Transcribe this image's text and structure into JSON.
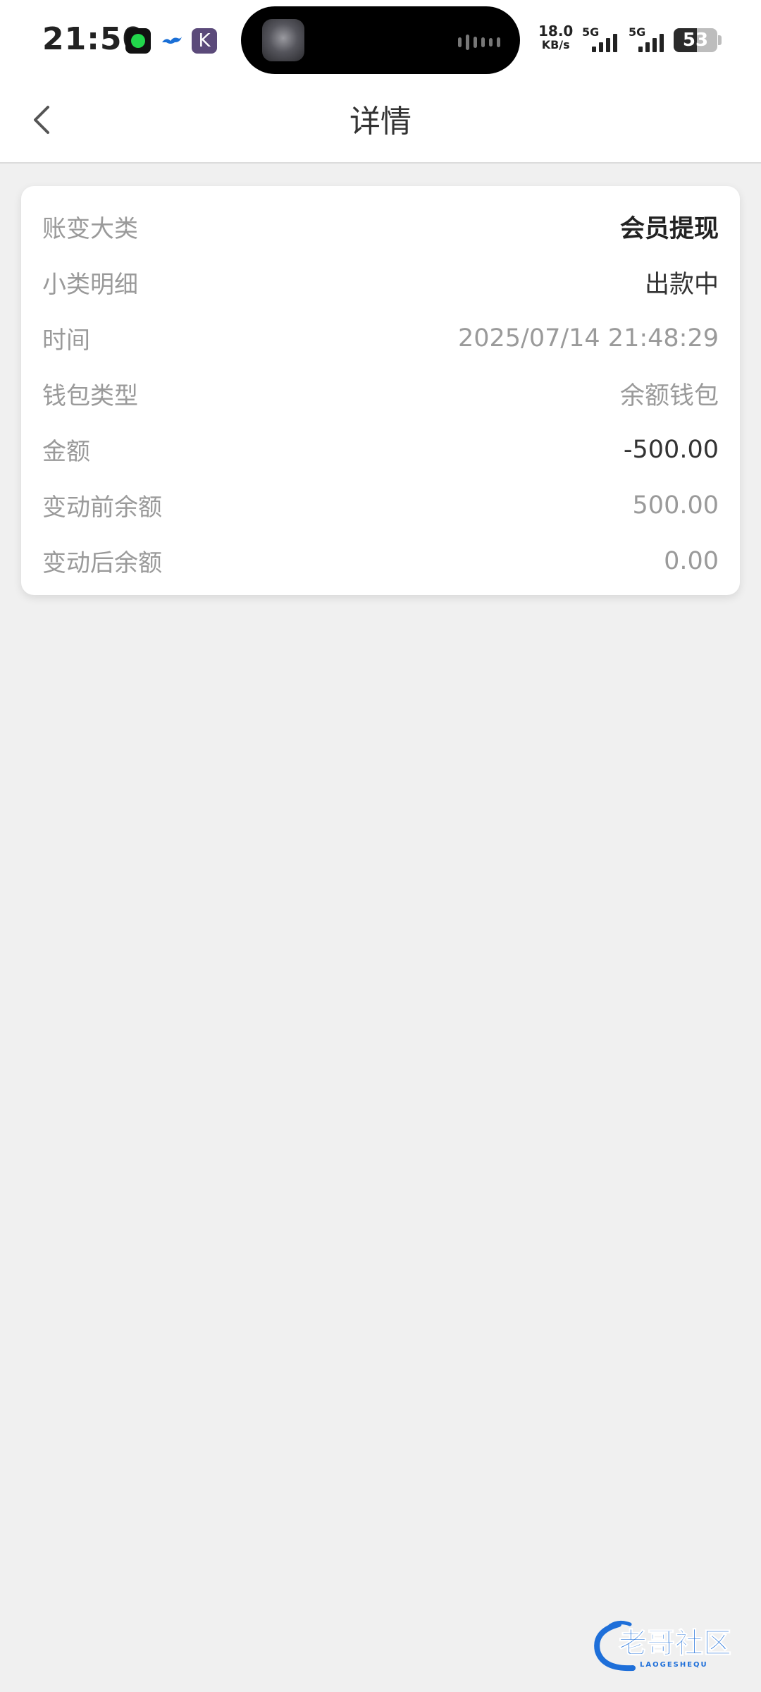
{
  "status_bar": {
    "time": "21:50",
    "net_speed_value": "18.0",
    "net_speed_unit": "KB/s",
    "signal1_label": "5G",
    "signal2_label": "5G",
    "battery_level": "53"
  },
  "header": {
    "title": "详情"
  },
  "detail": {
    "rows": [
      {
        "label": "账变大类",
        "value": "会员提现"
      },
      {
        "label": "小类明细",
        "value": "出款中"
      },
      {
        "label": "时间",
        "value": "2025/07/14 21:48:29"
      },
      {
        "label": "钱包类型",
        "value": "余额钱包"
      },
      {
        "label": "金额",
        "value": "-500.00"
      },
      {
        "label": "变动前余额",
        "value": "500.00"
      },
      {
        "label": "变动后余额",
        "value": "0.00"
      }
    ]
  },
  "watermark": {
    "text": "老哥社区",
    "subtext": "LAOGESHEQU"
  },
  "colors": {
    "page_bg": "#f0f0f0",
    "card_bg": "#ffffff",
    "label_gray": "#9a9a9a",
    "value_dark": "#222222",
    "watermark_blue": "#1e6fd9"
  }
}
